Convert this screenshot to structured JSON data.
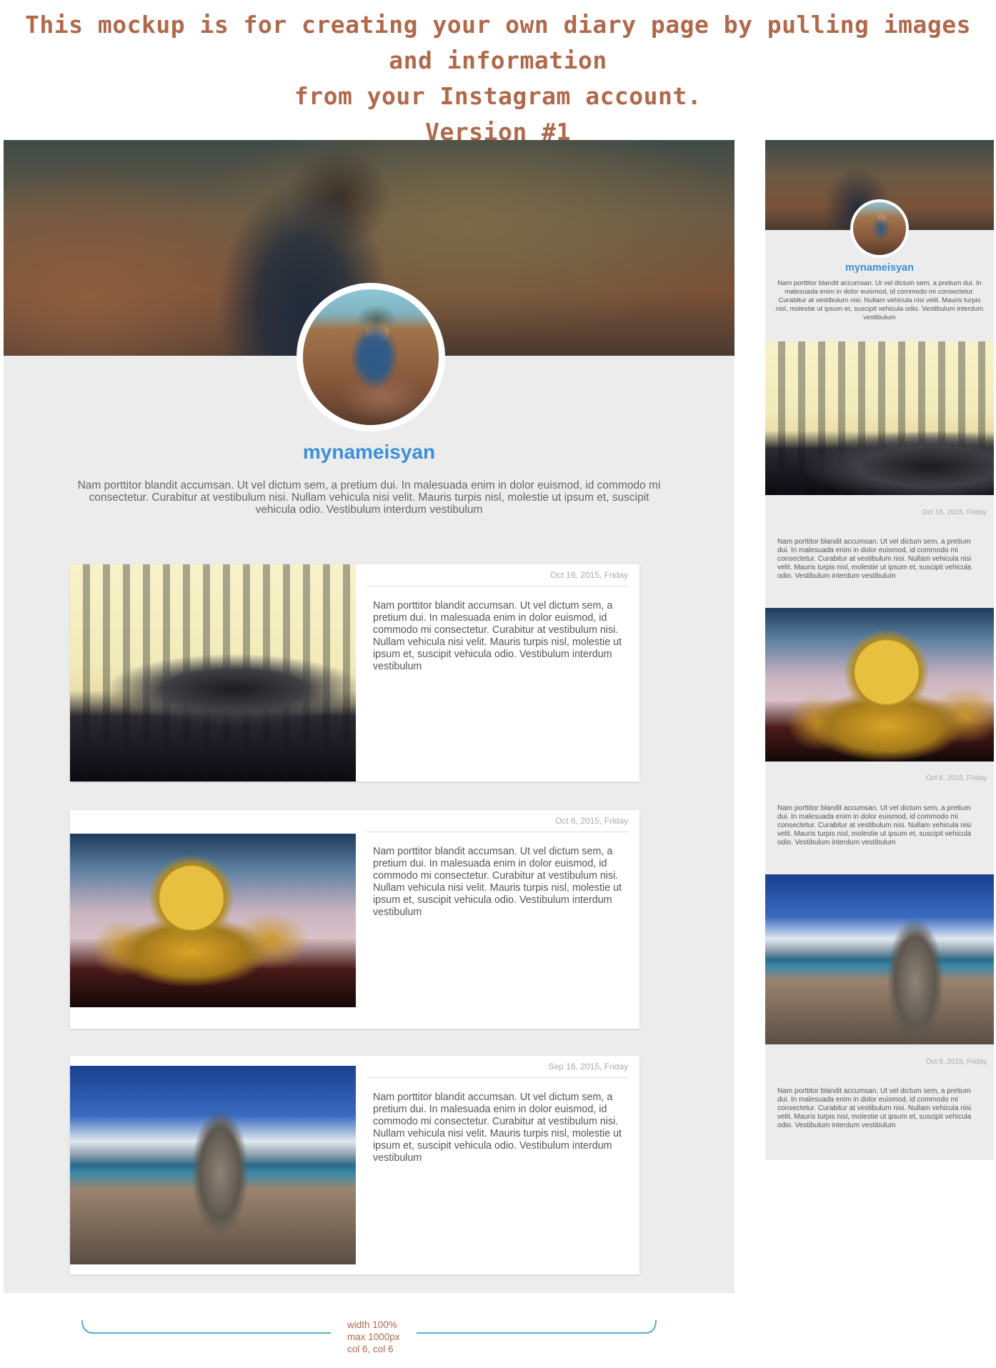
{
  "heading": {
    "line1": "This mockup is for creating your own diary page by pulling images and information",
    "line2": "from  your Instagram account.",
    "line3": "Version #1"
  },
  "profile": {
    "username": "mynameisyan",
    "bio": "Nam porttitor blandit accumsan. Ut vel dictum sem, a pretium dui. In malesuada enim in dolor euismod, id commodo mi consectetur. Curabitur at vestibulum nisi. Nullam vehicula nisi velit. Mauris turpis nisl, molestie ut ipsum et, suscipit vehicula odio. Vestibulum interdum vestibulum"
  },
  "posts": [
    {
      "date": "Oct 16, 2015, Friday",
      "text": "Nam porttitor blandit accumsan. Ut vel dictum sem, a pretium dui. In malesuada enim in dolor euismod, id commodo mi consectetur. Curabitur at vestibulum nisi. Nullam vehicula nisi velit. Mauris turpis nisl, molestie ut ipsum et, suscipit vehicula odio. Vestibulum interdum vestibulum",
      "image": "iguana-photo"
    },
    {
      "date": "Oct 6, 2015, Friday",
      "text": "Nam porttitor blandit accumsan. Ut vel dictum sem, a pretium dui. In malesuada enim in dolor euismod, id commodo mi consectetur. Curabitur at vestibulum nisi. Nullam vehicula nisi velit. Mauris turpis nisl, molestie ut ipsum et, suscipit vehicula odio. Vestibulum interdum vestibulum",
      "image": "dharma-wheel-photo"
    },
    {
      "date": "Sep 16, 2015, Friday",
      "text": "Nam porttitor blandit accumsan. Ut vel dictum sem, a pretium dui. In malesuada enim in dolor euismod, id commodo mi consectetur. Curabitur at vestibulum nisi. Nullam vehicula nisi velit. Mauris turpis nisl, molestie ut ipsum et, suscipit vehicula odio. Vestibulum interdum vestibulum",
      "image": "stone-stack-photo"
    }
  ],
  "mobile": {
    "username": "mynameisyan",
    "bio": "Nam porttitor blandit accumsan. Ut vel dictum sem, a pretium dui. In malesuada enim in dolor euismod, id commodo mi consectetur. Curabitur at vestibulum nisi. Nullam vehicula nisi velit. Mauris turpis nisl, molestie ut ipsum et, suscipit vehicula odio. Vestibulum interdum vestibulum",
    "posts": [
      {
        "date": "Oct 16, 2015, Friday",
        "text": "Nam porttitor blandit accumsan. Ut vel dictum sem, a pretium dui. In malesuada enim in dolor euismod, id commodo mi consectetur. Curabitur at vestibulum nisi. Nullam vehicula nisi velit. Mauris turpis nisl, molestie ut ipsum et, suscipit vehicula odio. Vestibulum interdum vestibulum"
      },
      {
        "date": "Oct 6, 2015, Friday",
        "text": "Nam porttitor blandit accumsan. Ut vel dictum sem, a pretium dui. In malesuada enim in dolor euismod, id commodo mi consectetur. Curabitur at vestibulum nisi. Nullam vehicula nisi velit. Mauris turpis nisl, molestie ut ipsum et, suscipit vehicula odio. Vestibulum interdum vestibulum"
      },
      {
        "date": "Oct 6, 2015, Friday",
        "text": "Nam porttitor blandit accumsan. Ut vel dictum sem, a pretium dui. In malesuada enim in dolor euismod, id commodo mi consectetur. Curabitur at vestibulum nisi. Nullam vehicula nisi velit. Mauris turpis nisl, molestie ut ipsum et, suscipit vehicula odio. Vestibulum interdum vestibulum"
      }
    ]
  },
  "annotation": {
    "line1": "width 100%",
    "line2": "max 1000px",
    "line3": "col 6, col 6"
  },
  "colors": {
    "heading": "#b0694b",
    "username": "#3b8fd9",
    "panel_bg": "#ececec",
    "bracket": "#5aaec8"
  }
}
